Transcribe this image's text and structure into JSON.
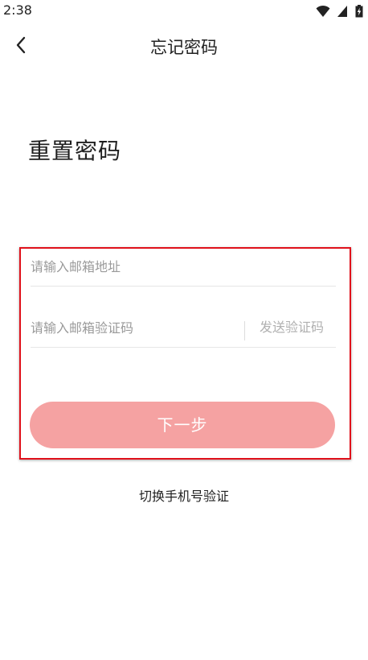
{
  "status_bar": {
    "time": "2:38",
    "icons": [
      "wifi-icon",
      "signal-icon",
      "battery-charging-icon"
    ]
  },
  "app_bar": {
    "back_icon": "chevron-left-icon",
    "title": "忘记密码"
  },
  "heading": "重置密码",
  "form": {
    "email_placeholder": "请输入邮箱地址",
    "email_value": "",
    "code_placeholder": "请输入邮箱验证码",
    "code_value": "",
    "send_code_label": "发送验证码",
    "next_label": "下一步"
  },
  "switch_link": "切换手机号验证",
  "colors": {
    "next_button": "#f5a2a2",
    "highlight_border": "#e0111b",
    "placeholder": "#9a9a9a",
    "send_code_text": "#b0b0b0"
  }
}
